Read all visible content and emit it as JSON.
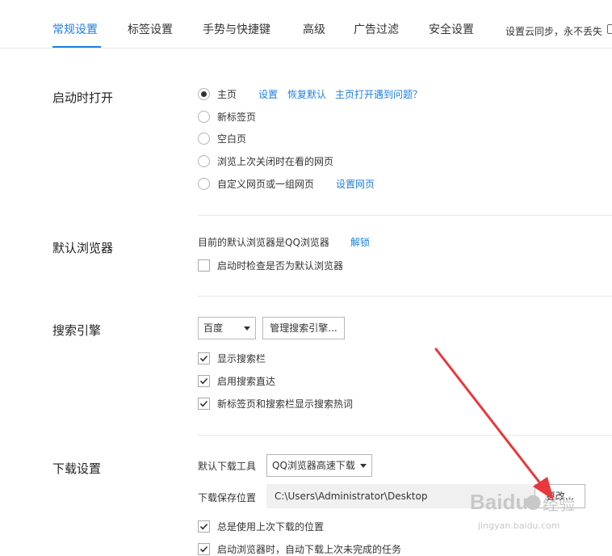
{
  "tabs": [
    {
      "label": "常规设置",
      "active": true
    },
    {
      "label": "标签设置",
      "active": false
    },
    {
      "label": "手势与快捷键",
      "active": false
    },
    {
      "label": "高级",
      "active": false
    },
    {
      "label": "广告过滤",
      "active": false
    },
    {
      "label": "安全设置",
      "active": false
    }
  ],
  "sync_text": "设置云同步，永不丢失",
  "startup": {
    "title": "启动时打开",
    "options": [
      {
        "label": "主页",
        "checked": true
      },
      {
        "label": "新标签页",
        "checked": false
      },
      {
        "label": "空白页",
        "checked": false
      },
      {
        "label": "浏览上次关闭时在看的网页",
        "checked": false
      },
      {
        "label": "自定义网页或一组网页",
        "checked": false
      }
    ],
    "links": {
      "settings": "设置",
      "restore_default": "恢复默认",
      "homepage_problem": "主页打开遇到问题？",
      "set_pages": "设置网页"
    }
  },
  "default_browser": {
    "title": "默认浏览器",
    "status": "目前的默认浏览器是QQ浏览器",
    "unlock": "解锁",
    "check_label": "启动时检查是否为默认浏览器",
    "check_checked": false
  },
  "search": {
    "title": "搜索引擎",
    "engine": "百度",
    "manage_button": "管理搜索引擎...",
    "options": [
      {
        "label": "显示搜索栏",
        "checked": true
      },
      {
        "label": "启用搜索直达",
        "checked": true
      },
      {
        "label": "新标签页和搜索栏显示搜索热词",
        "checked": true
      }
    ]
  },
  "download": {
    "title": "下载设置",
    "tool_label": "默认下载工具",
    "tool_value": "QQ浏览器高速下载",
    "path_label": "下载保存位置",
    "path_value": "C:\\Users\\Administrator\\Desktop",
    "change_button": "更改...",
    "options": [
      {
        "label": "总是使用上次下载的位置",
        "checked": true
      },
      {
        "label": "启动浏览器时，自动下载上次未完成的任务",
        "checked": true
      }
    ]
  },
  "watermark": {
    "brand": "Baidu",
    "cn": "经验",
    "url": "jingyan.baidu.com"
  },
  "colors": {
    "accent": "#1e7fe0",
    "arrow": "#e8383d"
  }
}
